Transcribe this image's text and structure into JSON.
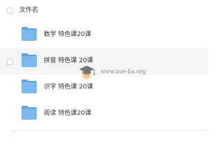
{
  "header": {
    "column_label": "文件名"
  },
  "files": [
    {
      "name": "数学 特色课20课",
      "icon": "folder-icon",
      "hovered": false
    },
    {
      "name": "拼音 特色课 20课",
      "icon": "folder-icon",
      "hovered": true
    },
    {
      "name": "识字 特色课 20课",
      "icon": "folder-icon",
      "hovered": false
    },
    {
      "name": "阅读 特色课20课",
      "icon": "folder-icon",
      "hovered": false
    }
  ],
  "watermark": {
    "text": "www.xue-ba.org"
  },
  "colors": {
    "folder": "#7bb8f0",
    "folder_tab": "#5fa2e6",
    "hover_row": "#f4f5f7",
    "text": "#333333"
  }
}
